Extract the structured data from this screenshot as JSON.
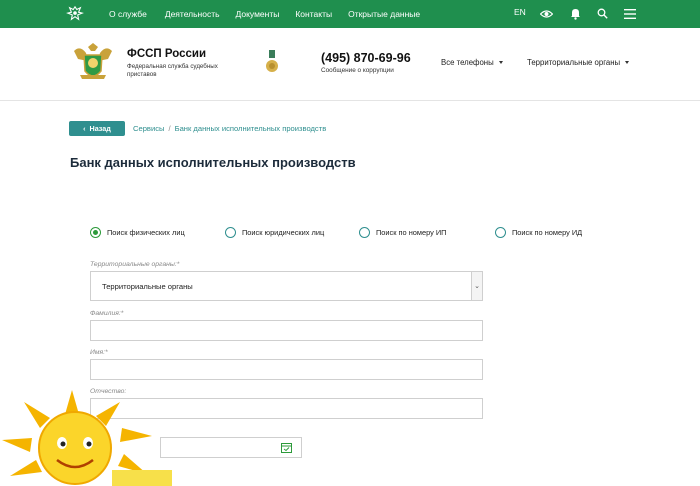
{
  "topbar": {
    "nav": [
      "О службе",
      "Деятельность",
      "Документы",
      "Контакты",
      "Открытые данные"
    ],
    "lang": "EN",
    "icons": [
      "eye-icon",
      "bell-icon",
      "search-icon",
      "menu-icon"
    ],
    "color": "#1f8f4e"
  },
  "header": {
    "org_title": "ФССП России",
    "org_subtitle": "Федеральная служба судебных приставов",
    "phone": "(495) 870-69-96",
    "phone_sub": "Сообщение о коррупции",
    "dropdowns": [
      "Все телефоны",
      "Территориальные органы"
    ]
  },
  "breadcrumb": {
    "back_label": "Назад",
    "items": [
      "Сервисы",
      "Банк данных исполнительных производств"
    ]
  },
  "page_title": "Банк данных исполнительных производств",
  "search_types": [
    {
      "label": "Поиск физических лиц",
      "selected": true
    },
    {
      "label": "Поиск юридических лиц",
      "selected": false
    },
    {
      "label": "Поиск по номеру ИП",
      "selected": false
    },
    {
      "label": "Поиск по номеру ИД",
      "selected": false
    }
  ],
  "form": {
    "territorial_label": "Территориальные органы:*",
    "territorial_value": "Территориальные органы",
    "surname_label": "Фамилия:*",
    "name_label": "Имя:*",
    "patronymic_label": "Отчество:"
  },
  "colors": {
    "accent": "#2f8f8f",
    "green": "#1f8f4e",
    "radio_selected": "#2c9a3a"
  }
}
